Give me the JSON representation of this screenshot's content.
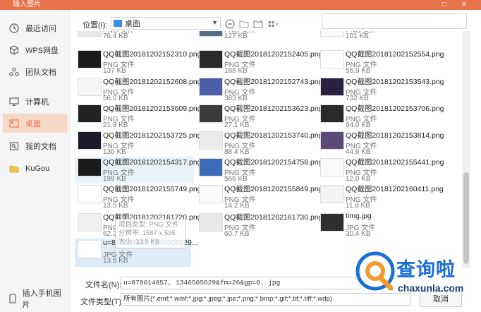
{
  "window": {
    "title": "插入图片",
    "maximize_glyph": "□",
    "close_glyph": "✕"
  },
  "sidebar": {
    "items": [
      {
        "label": "最近访问",
        "icon": "clock-icon"
      },
      {
        "label": "WPS网盘",
        "icon": "cube-icon"
      },
      {
        "label": "团队文档",
        "icon": "team-icon"
      },
      {
        "label": "计算机",
        "icon": "monitor-icon"
      },
      {
        "label": "桌面",
        "icon": "desktop-icon",
        "active": true
      },
      {
        "label": "我的文档",
        "icon": "documents-icon"
      },
      {
        "label": "KuGou",
        "icon": "folder-icon"
      }
    ],
    "bottom_label": "插入手机图片"
  },
  "toolbar": {
    "location_label": "位置(I):",
    "location_value": "桌面",
    "icons": [
      "back-icon",
      "up-folder-icon",
      "new-folder-icon",
      "view-menu-icon"
    ]
  },
  "files": [
    {
      "name": "",
      "type": "PNG 文件",
      "size": "76.4 KB",
      "partial": true
    },
    {
      "name": "",
      "type": "PNG 文件",
      "size": "127 KB",
      "partial": true
    },
    {
      "name": "",
      "type": "PNG 文件",
      "size": "101 KB",
      "partial": true
    },
    {
      "name": "QQ截图20181202152310.png",
      "type": "PNG 文件",
      "size": "137 KB"
    },
    {
      "name": "QQ截图20181202152405.png",
      "type": "PNG 文件",
      "size": "188 KB"
    },
    {
      "name": "QQ截图20181202152554.png",
      "type": "PNG 文件",
      "size": "56.9 KB"
    },
    {
      "name": "QQ截图20181202152608.png",
      "type": "PNG 文件",
      "size": "56.0 KB"
    },
    {
      "name": "QQ截图20181202152743.png",
      "type": "PNG 文件",
      "size": "383 KB"
    },
    {
      "name": "QQ截图20181202153543.png",
      "type": "PNG 文件",
      "size": "732 KB"
    },
    {
      "name": "QQ截图20181202153609.png",
      "type": "PNG 文件",
      "size": "21.8 KB"
    },
    {
      "name": "QQ截图20181202153623.png",
      "type": "PNG 文件",
      "size": "27.1 KB"
    },
    {
      "name": "QQ截图20181202153706.png",
      "type": "PNG 文件",
      "size": "94.0 KB"
    },
    {
      "name": "QQ截图20181202153725.png",
      "type": "PNG 文件",
      "size": "130 KB"
    },
    {
      "name": "QQ截图20181202153740.png",
      "type": "PNG 文件",
      "size": "88.4 KB"
    },
    {
      "name": "QQ截图20181202153814.png",
      "type": "PNG 文件",
      "size": "44.6 KB"
    },
    {
      "name": "QQ截图20181202154317.png",
      "type": "PNG 文件",
      "size": "199 KB",
      "hover": true
    },
    {
      "name": "QQ截图20181202154758.png",
      "type": "PNG 文件",
      "size": "566 KB"
    },
    {
      "name": "QQ截图20181202155441.png",
      "type": "PNG 文件",
      "size": "12.0 KB"
    },
    {
      "name": "QQ截图20181202155749.png",
      "type": "PNG 文件",
      "size": "13.5 KB"
    },
    {
      "name": "QQ截图20181202155849.png",
      "type": "PNG 文件",
      "size": "14.2 KB"
    },
    {
      "name": "QQ截图20181202160411.png",
      "type": "PNG 文件",
      "size": "11.8 KB"
    },
    {
      "name": "QQ截图20181202161720.png",
      "type": "PNG 文件",
      "size": "62.3"
    },
    {
      "name": "QQ截图20181202161730.png",
      "type": "PNG 文件",
      "size": "60.7 KB"
    },
    {
      "name": "timg.jpg",
      "type": "JPG 文件",
      "size": "30.4 KB"
    },
    {
      "name": "u=878614857,1346505629...",
      "type": "JPG 文件",
      "size": "13.5 KB",
      "selected": true
    }
  ],
  "tooltip": {
    "line1": "项目类型: PNG 文件",
    "line2": "分辨率: 1587 x 595",
    "line3": "大小: 13.5 KB"
  },
  "bottom": {
    "filename_label": "文件名(N):",
    "filename_value": "u=878614857, 1346505629&fm=26&gp=0. jpg",
    "filetype_label": "文件类型(T):",
    "filetype_value": "所有图片(*.emf;*.wmf;*.jpg;*.jpeg;*.jpe;*.png;*.bmp;*.gif;*.tif;*.tiff;*.wdp)",
    "cancel_label": "取消"
  },
  "watermark": {
    "brand": "查询啦",
    "url": "chaxunla.com"
  },
  "colors": {
    "accent": "#e8734a",
    "selected": "#dcecf9",
    "watermark_blue": "#1a6fd6",
    "watermark_orange": "#f29a2e"
  }
}
